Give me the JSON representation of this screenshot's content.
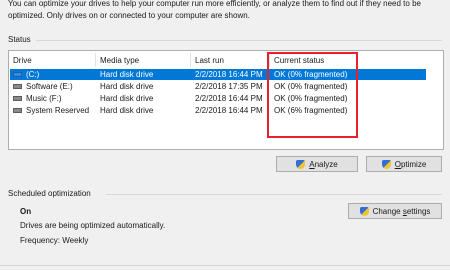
{
  "intro": {
    "line1": "You can optimize your drives to help your computer run more efficiently, or analyze them to find out if they need to be",
    "line2": "optimized. Only drives on or connected to your computer are shown."
  },
  "status_section": {
    "label": "Status"
  },
  "table": {
    "headers": [
      "Drive",
      "Media type",
      "Last run",
      "Current status"
    ],
    "rows": [
      {
        "drive": "(C:)",
        "media": "Hard disk drive",
        "last_run": "2/2/2018 16:44 PM",
        "status": "OK (0% fragmented)",
        "selected": true
      },
      {
        "drive": "Software (E:)",
        "media": "Hard disk drive",
        "last_run": "2/2/2018 17:35 PM",
        "status": "OK (0% fragmented)",
        "selected": false
      },
      {
        "drive": "Music (F:)",
        "media": "Hard disk drive",
        "last_run": "2/2/2018 16:44 PM",
        "status": "OK (0% fragmented)",
        "selected": false
      },
      {
        "drive": "System Reserved",
        "media": "Hard disk drive",
        "last_run": "2/2/2018 16:44 PM",
        "status": "OK (6% fragmented)",
        "selected": false
      }
    ]
  },
  "buttons": {
    "analyze_prefix": "",
    "analyze_key": "A",
    "analyze_rest": "nalyze",
    "optimize_prefix": "",
    "optimize_key": "O",
    "optimize_rest": "ptimize",
    "change_prefix": "Change ",
    "change_key": "s",
    "change_rest": "ettings"
  },
  "scheduled": {
    "label": "Scheduled optimization",
    "state": "On",
    "description": "Drives are being optimized automatically.",
    "frequency": "Frequency: Weekly"
  },
  "colors": {
    "selection": "#0078d7",
    "highlight_box": "#e8202a"
  }
}
